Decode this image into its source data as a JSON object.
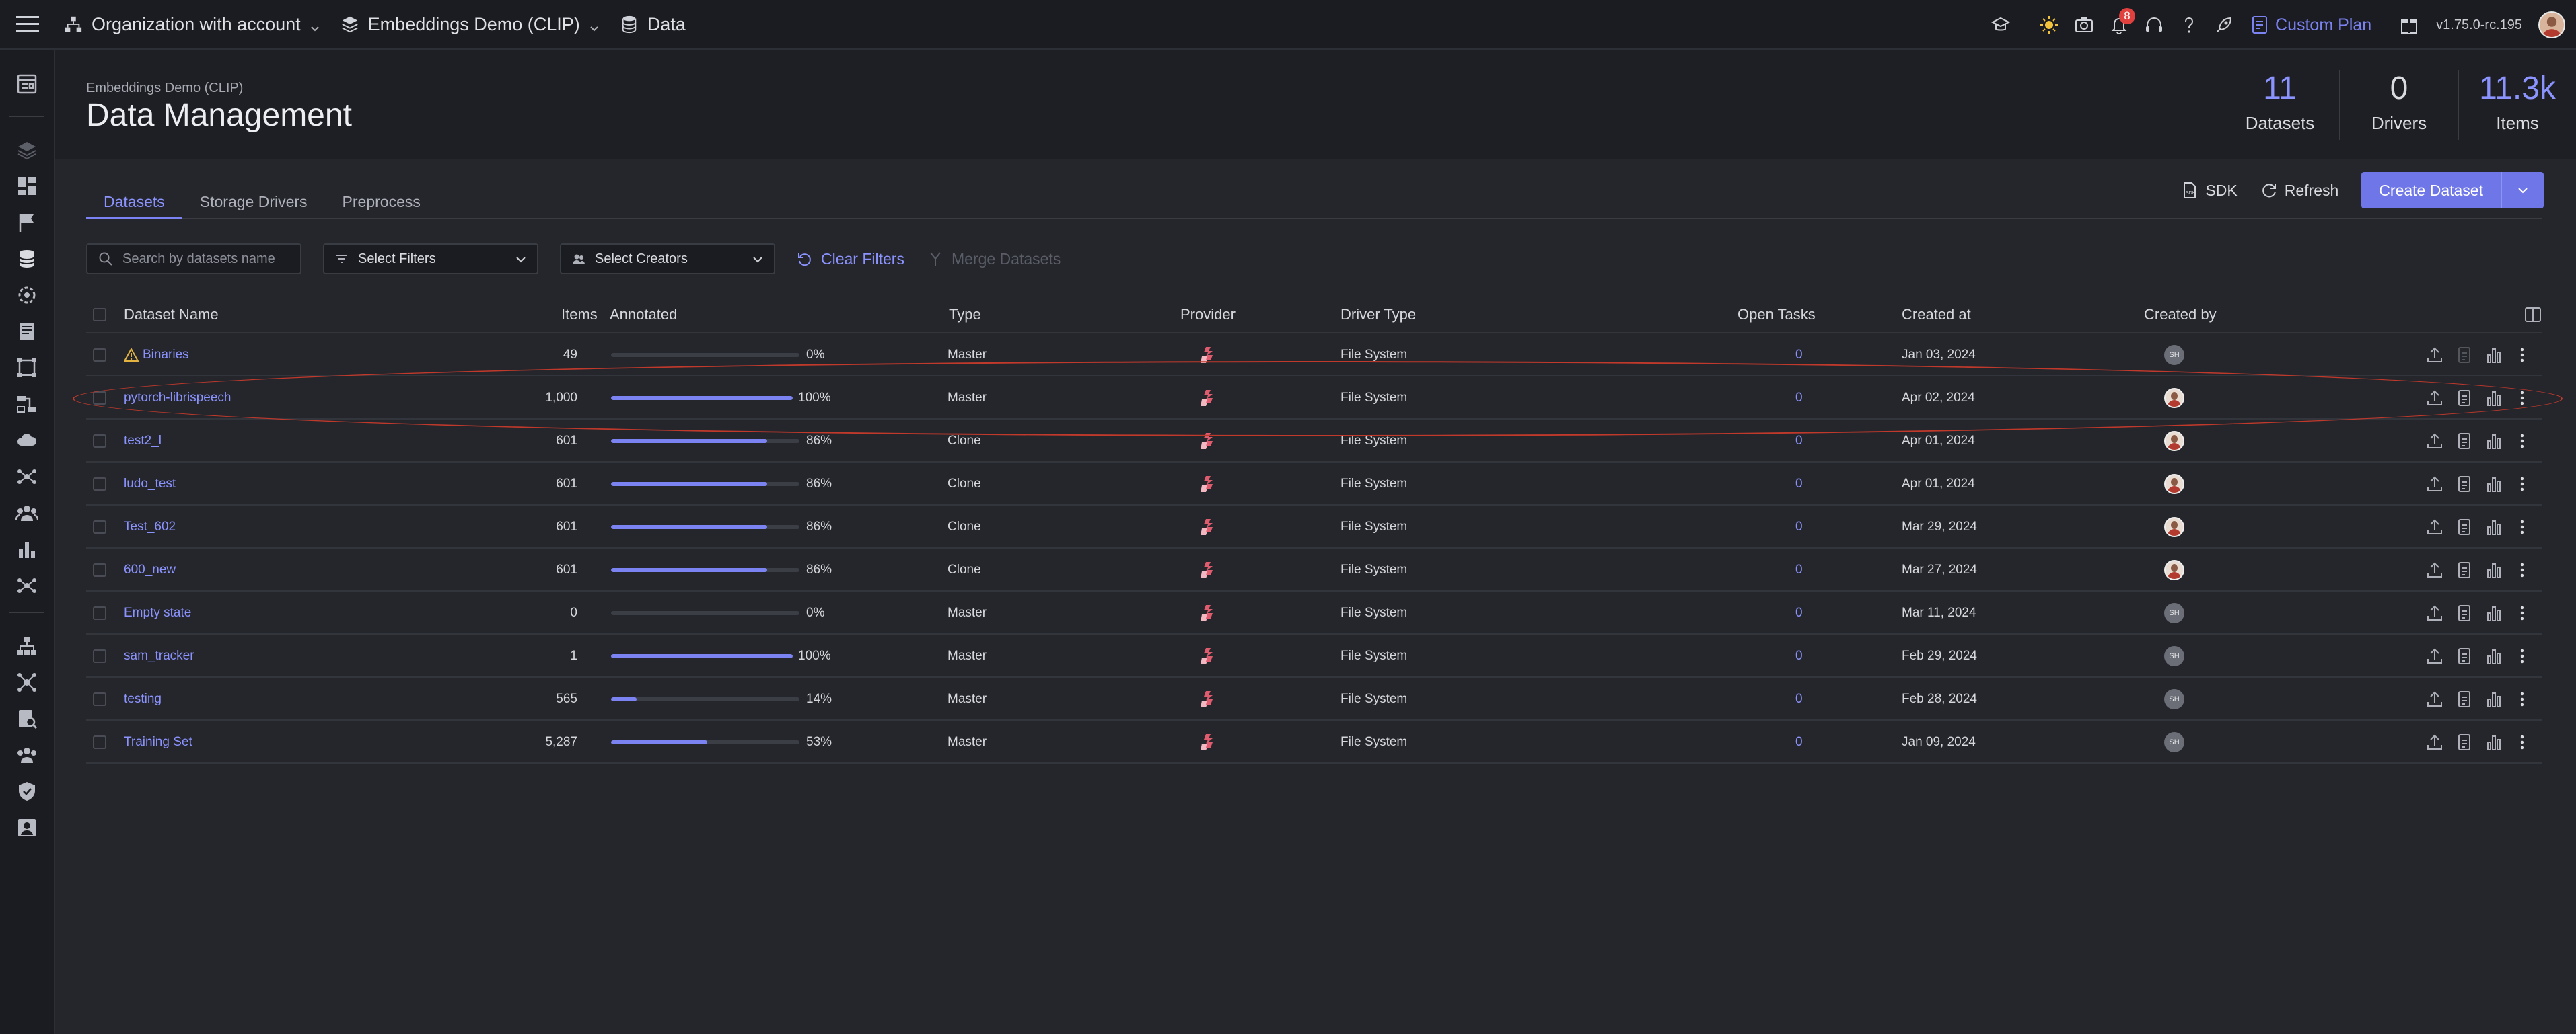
{
  "topbar": {
    "organization": "Organization with account",
    "project": "Embeddings Demo (CLIP)",
    "section": "Data",
    "notification_count": "8",
    "plan": "Custom Plan",
    "version": "v1.75.0-rc.195"
  },
  "header": {
    "subtitle": "Embeddings Demo (CLIP)",
    "title": "Data Management",
    "stats": [
      {
        "value": "11",
        "label": "Datasets"
      },
      {
        "value": "0",
        "label": "Drivers"
      },
      {
        "value": "11.3k",
        "label": "Items"
      }
    ]
  },
  "tabs": [
    "Datasets",
    "Storage Drivers",
    "Preprocess"
  ],
  "actions": {
    "sdk": "SDK",
    "refresh": "Refresh",
    "create": "Create Dataset"
  },
  "filters": {
    "search_placeholder": "Search by datasets name",
    "select_filters": "Select Filters",
    "select_creators": "Select Creators",
    "clear": "Clear Filters",
    "merge": "Merge Datasets"
  },
  "table": {
    "columns": [
      "Dataset Name",
      "Items",
      "Annotated",
      "Type",
      "Provider",
      "Driver Type",
      "Open Tasks",
      "Created at",
      "Created by"
    ],
    "rows": [
      {
        "name": "Binaries",
        "warning": true,
        "items": "49",
        "annotated": 0,
        "pct": "0%",
        "type": "Master",
        "driver": "File System",
        "open": "0",
        "created": "Jan 03, 2024",
        "by": "SH"
      },
      {
        "name": "pytorch-librispeech",
        "warning": false,
        "items": "1,000",
        "annotated": 100,
        "pct": "100%",
        "type": "Master",
        "driver": "File System",
        "open": "0",
        "created": "Apr 02, 2024",
        "by": "img"
      },
      {
        "name": "test2_l",
        "warning": false,
        "items": "601",
        "annotated": 86,
        "pct": "86%",
        "type": "Clone",
        "driver": "File System",
        "open": "0",
        "created": "Apr 01, 2024",
        "by": "img"
      },
      {
        "name": "ludo_test",
        "warning": false,
        "items": "601",
        "annotated": 86,
        "pct": "86%",
        "type": "Clone",
        "driver": "File System",
        "open": "0",
        "created": "Apr 01, 2024",
        "by": "img"
      },
      {
        "name": "Test_602",
        "warning": false,
        "items": "601",
        "annotated": 86,
        "pct": "86%",
        "type": "Clone",
        "driver": "File System",
        "open": "0",
        "created": "Mar 29, 2024",
        "by": "img"
      },
      {
        "name": "600_new",
        "warning": false,
        "items": "601",
        "annotated": 86,
        "pct": "86%",
        "type": "Clone",
        "driver": "File System",
        "open": "0",
        "created": "Mar 27, 2024",
        "by": "img"
      },
      {
        "name": "Empty state",
        "warning": false,
        "items": "0",
        "annotated": 0,
        "pct": "0%",
        "type": "Master",
        "driver": "File System",
        "open": "0",
        "created": "Mar 11, 2024",
        "by": "SH"
      },
      {
        "name": "sam_tracker",
        "warning": false,
        "items": "1",
        "annotated": 100,
        "pct": "100%",
        "type": "Master",
        "driver": "File System",
        "open": "0",
        "created": "Feb 29, 2024",
        "by": "SH"
      },
      {
        "name": "testing",
        "warning": false,
        "items": "565",
        "annotated": 14,
        "pct": "14%",
        "type": "Master",
        "driver": "File System",
        "open": "0",
        "created": "Feb 28, 2024",
        "by": "SH"
      },
      {
        "name": "Training Set",
        "warning": false,
        "items": "5,287",
        "annotated": 53,
        "pct": "53%",
        "type": "Master",
        "driver": "File System",
        "open": "0",
        "created": "Jan 09, 2024",
        "by": "SH"
      }
    ]
  },
  "colors": {
    "accent": "#7b83f2",
    "highlight": "#c0392b",
    "badge": "#e0413f"
  }
}
